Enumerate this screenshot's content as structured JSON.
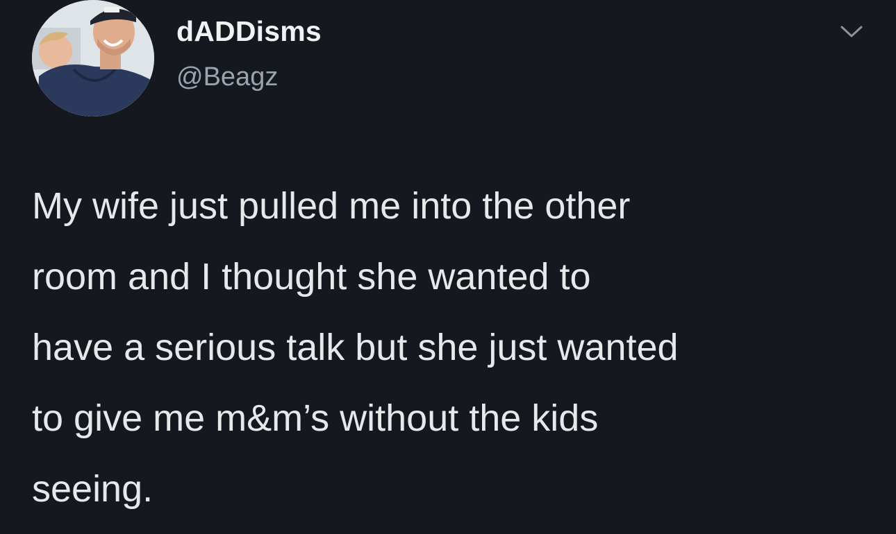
{
  "tweet": {
    "author": {
      "display_name": "dADDisms",
      "handle": "@Beagz",
      "avatar_icon": "user-photo-avatar"
    },
    "menu_icon": "chevron-down-icon",
    "text": "My wife just pulled me into the other\nroom and I thought she wanted to\nhave a serious talk but she just wanted\nto give me m&m’s without the kids\nseeing."
  },
  "colors": {
    "background": "#15181f",
    "primary_text": "#e6e8ea",
    "secondary_text": "#9aa4ad"
  }
}
